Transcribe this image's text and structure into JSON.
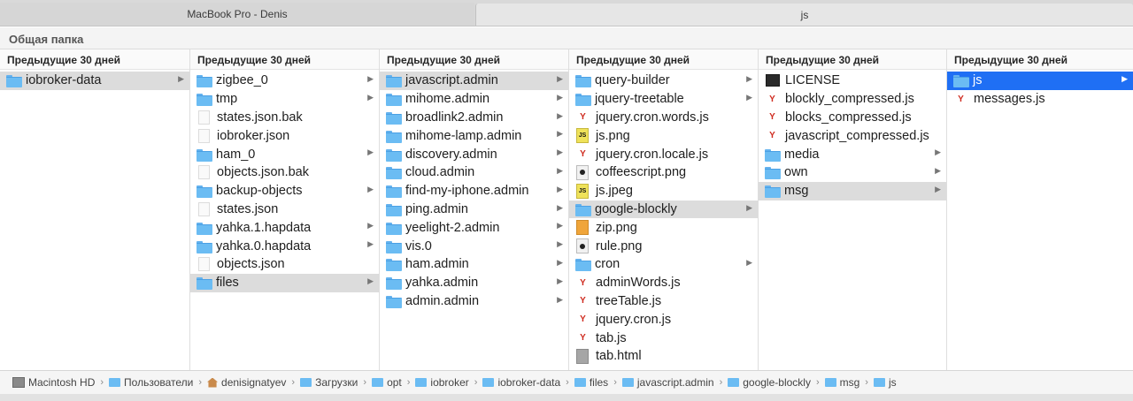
{
  "tabs": [
    "MacBook Pro - Denis",
    "js"
  ],
  "subtitle": "Общая папка",
  "columns": [
    {
      "header": "Предыдущие 30 дней",
      "items": [
        {
          "label": "iobroker-data",
          "type": "folder",
          "selected": "gray",
          "has_children": true
        }
      ]
    },
    {
      "header": "Предыдущие 30 дней",
      "items": [
        {
          "label": "zigbee_0",
          "type": "folder",
          "has_children": true
        },
        {
          "label": "tmp",
          "type": "folder",
          "has_children": true
        },
        {
          "label": "states.json.bak",
          "type": "doc"
        },
        {
          "label": "iobroker.json",
          "type": "doc"
        },
        {
          "label": "ham_0",
          "type": "folder",
          "has_children": true
        },
        {
          "label": "objects.json.bak",
          "type": "doc"
        },
        {
          "label": "backup-objects",
          "type": "folder",
          "has_children": true
        },
        {
          "label": "states.json",
          "type": "doc"
        },
        {
          "label": "yahka.1.hapdata",
          "type": "folder",
          "has_children": true
        },
        {
          "label": "yahka.0.hapdata",
          "type": "folder",
          "has_children": true
        },
        {
          "label": "objects.json",
          "type": "doc"
        },
        {
          "label": "files",
          "type": "folder",
          "selected": "gray",
          "has_children": true
        }
      ]
    },
    {
      "header": "Предыдущие 30 дней",
      "items": [
        {
          "label": "javascript.admin",
          "type": "folder",
          "selected": "gray",
          "has_children": true
        },
        {
          "label": "mihome.admin",
          "type": "folder",
          "has_children": true
        },
        {
          "label": "broadlink2.admin",
          "type": "folder",
          "has_children": true
        },
        {
          "label": "mihome-lamp.admin",
          "type": "folder",
          "has_children": true
        },
        {
          "label": "discovery.admin",
          "type": "folder",
          "has_children": true
        },
        {
          "label": "cloud.admin",
          "type": "folder",
          "has_children": true
        },
        {
          "label": "find-my-iphone.admin",
          "type": "folder",
          "has_children": true
        },
        {
          "label": "ping.admin",
          "type": "folder",
          "has_children": true
        },
        {
          "label": "yeelight-2.admin",
          "type": "folder",
          "has_children": true
        },
        {
          "label": "vis.0",
          "type": "folder",
          "has_children": true
        },
        {
          "label": "ham.admin",
          "type": "folder",
          "has_children": true
        },
        {
          "label": "yahka.admin",
          "type": "folder",
          "has_children": true
        },
        {
          "label": "admin.admin",
          "type": "folder",
          "has_children": true
        }
      ]
    },
    {
      "header": "Предыдущие 30 дней",
      "items": [
        {
          "label": "query-builder",
          "type": "folder",
          "has_children": true
        },
        {
          "label": "jquery-treetable",
          "type": "folder",
          "has_children": true
        },
        {
          "label": "jquery.cron.words.js",
          "type": "js"
        },
        {
          "label": "js.png",
          "type": "img-js"
        },
        {
          "label": "jquery.cron.locale.js",
          "type": "js"
        },
        {
          "label": "coffeescript.png",
          "type": "img-dark"
        },
        {
          "label": "js.jpeg",
          "type": "img-js"
        },
        {
          "label": "google-blockly",
          "type": "folder",
          "selected": "gray",
          "has_children": true
        },
        {
          "label": "zip.png",
          "type": "img-orange"
        },
        {
          "label": "rule.png",
          "type": "img-dark"
        },
        {
          "label": "cron",
          "type": "folder",
          "has_children": true
        },
        {
          "label": "adminWords.js",
          "type": "js"
        },
        {
          "label": "treeTable.js",
          "type": "js"
        },
        {
          "label": "jquery.cron.js",
          "type": "js"
        },
        {
          "label": "tab.js",
          "type": "js"
        },
        {
          "label": "tab.html",
          "type": "img-gray"
        }
      ]
    },
    {
      "header": "Предыдущие 30 дней",
      "items": [
        {
          "label": "LICENSE",
          "type": "term"
        },
        {
          "label": "blockly_compressed.js",
          "type": "js"
        },
        {
          "label": "blocks_compressed.js",
          "type": "js"
        },
        {
          "label": "javascript_compressed.js",
          "type": "js"
        },
        {
          "label": "media",
          "type": "folder",
          "has_children": true
        },
        {
          "label": "own",
          "type": "folder",
          "has_children": true
        },
        {
          "label": "msg",
          "type": "folder",
          "selected": "gray",
          "has_children": true
        }
      ]
    },
    {
      "header": "Предыдущие 30 дней",
      "items": [
        {
          "label": "js",
          "type": "folder",
          "selected": "blue",
          "has_children": true
        },
        {
          "label": "messages.js",
          "type": "js"
        }
      ]
    }
  ],
  "pathbar": [
    {
      "label": "Macintosh HD",
      "icon": "drive"
    },
    {
      "label": "Пользователи",
      "icon": "folder"
    },
    {
      "label": "denisignatyev",
      "icon": "home"
    },
    {
      "label": "Загрузки",
      "icon": "folder"
    },
    {
      "label": "opt",
      "icon": "folder"
    },
    {
      "label": "iobroker",
      "icon": "folder"
    },
    {
      "label": "iobroker-data",
      "icon": "folder"
    },
    {
      "label": "files",
      "icon": "folder"
    },
    {
      "label": "javascript.admin",
      "icon": "folder"
    },
    {
      "label": "google-blockly",
      "icon": "folder"
    },
    {
      "label": "msg",
      "icon": "folder"
    },
    {
      "label": "js",
      "icon": "folder"
    }
  ],
  "icon_glyphs": {
    "js_file": "Y",
    "js_image": "JS",
    "chevron": "▶",
    "path_separator": "›"
  }
}
